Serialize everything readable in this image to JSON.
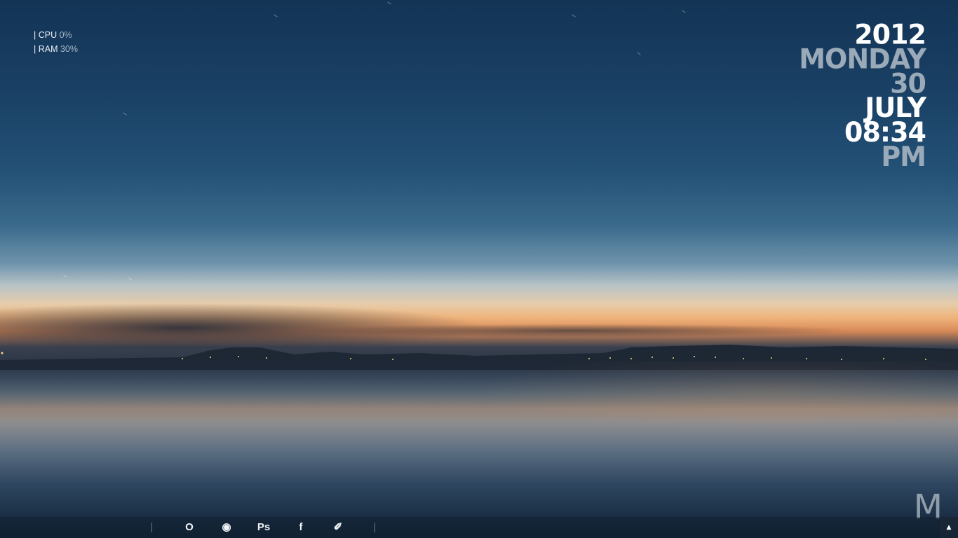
{
  "system_monitor": {
    "cpu_label": "| CPU",
    "cpu_value": "0%",
    "ram_label": "| RAM",
    "ram_value": "30%"
  },
  "clock": {
    "year": "2012",
    "weekday": "MONDAY",
    "day": "30",
    "month": "JULY",
    "time": "08:34",
    "meridiem": "PM"
  },
  "logo": {
    "letter": "M"
  },
  "taskbar": {
    "items": [
      {
        "label": "O",
        "icon": "opera-icon"
      },
      {
        "label": "◉",
        "icon": "chrome-icon"
      },
      {
        "label": "Ps",
        "icon": "photoshop-icon"
      },
      {
        "label": "f",
        "icon": "facebook-icon"
      },
      {
        "label": "✐",
        "icon": "pen-tool-icon"
      }
    ],
    "tray_arrow": "▲"
  },
  "colors": {
    "clock_primary": "#ffffff",
    "clock_secondary": "#9aaab8",
    "monitor_value": "#a9b9c6"
  }
}
